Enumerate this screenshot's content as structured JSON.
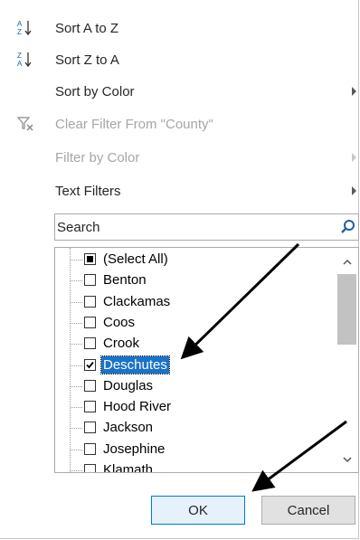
{
  "menu": {
    "sort_a_z": "Sort A to Z",
    "sort_z_a": "Sort Z to A",
    "sort_by_color": "Sort by Color",
    "clear_filter": "Clear Filter From \"County\"",
    "filter_by_color": "Filter by Color",
    "text_filters": "Text Filters"
  },
  "search": {
    "placeholder": "Search"
  },
  "list": {
    "items": [
      {
        "label": "(Select All)",
        "state": "partial"
      },
      {
        "label": "Benton",
        "state": "unchecked"
      },
      {
        "label": "Clackamas",
        "state": "unchecked"
      },
      {
        "label": "Coos",
        "state": "unchecked"
      },
      {
        "label": "Crook",
        "state": "unchecked"
      },
      {
        "label": "Deschutes",
        "state": "checked",
        "selected": true
      },
      {
        "label": "Douglas",
        "state": "unchecked"
      },
      {
        "label": "Hood River",
        "state": "unchecked"
      },
      {
        "label": "Jackson",
        "state": "unchecked"
      },
      {
        "label": "Josephine",
        "state": "unchecked"
      },
      {
        "label": "Klamath",
        "state": "unchecked"
      }
    ]
  },
  "buttons": {
    "ok": "OK",
    "cancel": "Cancel"
  },
  "colors": {
    "selection": "#1a73c9",
    "ok_border": "#0078d7",
    "disabled_text": "#a6a6a6",
    "search_icon": "#1e5fa8"
  }
}
